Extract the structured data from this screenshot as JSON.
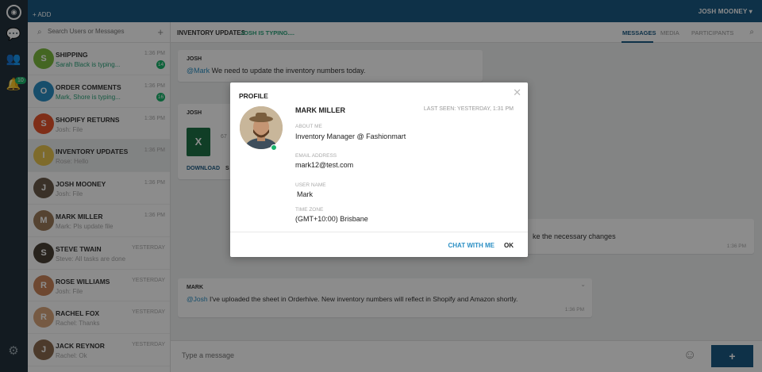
{
  "topbar": {
    "add_label": "+ ADD",
    "user_name": "JOSH MOONEY ▾"
  },
  "rail": {
    "logo": "◉",
    "notification_count": "10"
  },
  "search": {
    "placeholder": "Search Users or Messages"
  },
  "conversations": [
    {
      "name": "SHIPPING",
      "sub": "Sarah Black is typing...",
      "time": "1:36 PM",
      "count": "14",
      "initial": "S",
      "color": "#7cbb3f",
      "typing": true
    },
    {
      "name": "ORDER COMMENTS",
      "sub": "Mark, Shore is typing...",
      "time": "1:36 PM",
      "count": "16",
      "initial": "O",
      "color": "#2b8fc4",
      "typing": true
    },
    {
      "name": "SHOPIFY RETURNS",
      "sub": "Josh: File",
      "time": "1:36 PM",
      "count": "",
      "initial": "S",
      "color": "#e8542c",
      "typing": false
    },
    {
      "name": "INVENTORY UPDATES",
      "sub": "Rose: Hello",
      "time": "1:36 PM",
      "count": "",
      "initial": "I",
      "color": "#e6c34f",
      "typing": false
    },
    {
      "name": "JOSH MOONEY",
      "sub": "Josh: File",
      "time": "1:36 PM",
      "count": "",
      "initial": "J",
      "color": "#6a5a4a",
      "typing": false
    },
    {
      "name": "MARK MILLER",
      "sub": "Mark: Pls update file",
      "time": "1:36 PM",
      "count": "",
      "initial": "M",
      "color": "#9b7b5a",
      "typing": false
    },
    {
      "name": "STEVE TWAIN",
      "sub": "Steve: All tasks are done",
      "time": "YESTERDAY",
      "count": "",
      "initial": "S",
      "color": "#4a4036",
      "typing": false
    },
    {
      "name": "ROSE WILLIAMS",
      "sub": "Josh: File",
      "time": "YESTERDAY",
      "count": "",
      "initial": "R",
      "color": "#c9845a",
      "typing": false
    },
    {
      "name": "RACHEL FOX",
      "sub": "Rachel: Thanks",
      "time": "YESTERDAY",
      "count": "",
      "initial": "R",
      "color": "#d8a57a",
      "typing": false
    },
    {
      "name": "JACK REYNOR",
      "sub": "Rachel: Ok",
      "time": "YESTERDAY",
      "count": "",
      "initial": "J",
      "color": "#8a6a4f",
      "typing": false
    }
  ],
  "main": {
    "title": "INVENTORY UPDATES",
    "typing": "JOSH IS TYPING....",
    "tabs": [
      "MESSAGES",
      "MEDIA",
      "PARTICIPANTS"
    ]
  },
  "messages": [
    {
      "who": "JOSH",
      "mention": "@Mark",
      "text": " We need to update the inventory numbers today.",
      "time": ""
    },
    {
      "who": "JOSH",
      "mention": "",
      "text": "",
      "time": "",
      "file_size": "67",
      "download": "DOWNLOAD",
      "share": "S"
    },
    {
      "who": "",
      "mention": "",
      "text": "ke the necessary changes",
      "time": "1:36 PM"
    },
    {
      "who": "MARK",
      "mention": "@Josh",
      "text": " I've uploaded the sheet in Orderhive. New inventory numbers will reflect in Shopify and Amazon shortly.",
      "time": "1:36 PM"
    }
  ],
  "composer": {
    "placeholder": "Type a message",
    "send": "+"
  },
  "profile": {
    "title": "PROFILE",
    "name": "MARK MILLER",
    "last_seen": "LAST SEEN: YESTERDAY, 1:31 PM",
    "about_label": "ABOUT ME",
    "about": "Inventory Manager @ Fashionmart",
    "email_label": "EMAIL ADDRESS",
    "email": "mark12@test.com",
    "username_label": "USER NAME",
    "username": "Mark",
    "timezone_label": "TIME ZONE",
    "timezone": "(GMT+10:00) Brisbane",
    "chat_label": "CHAT WITH ME",
    "ok_label": "OK"
  },
  "colors": {
    "brand": "#1b5a84",
    "accent": "#2b8fc4",
    "online": "#19b36b",
    "rail": "#24323d"
  }
}
